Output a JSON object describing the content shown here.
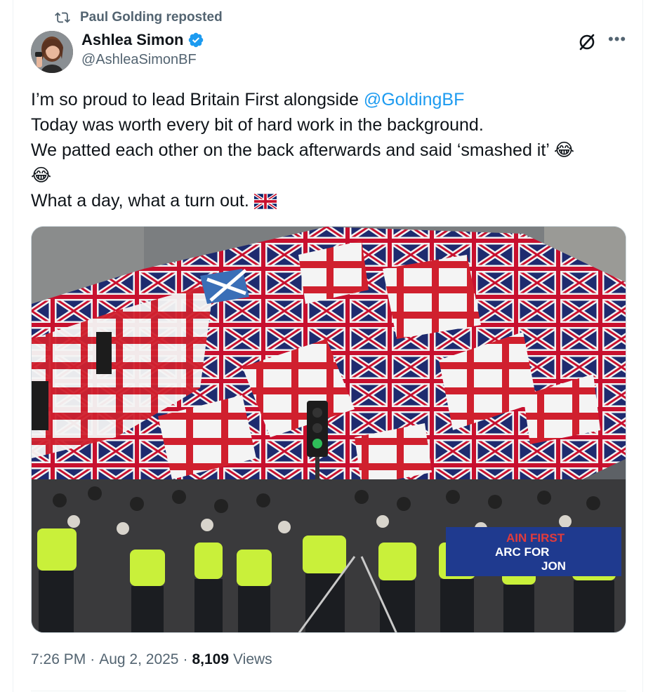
{
  "repost": {
    "text": "Paul Golding reposted"
  },
  "author": {
    "display_name": "Ashlea Simon",
    "handle": "@AshleaSimonBF",
    "verified": true
  },
  "tweet": {
    "line1_prefix": "I’m so proud to lead Britain First alongside ",
    "line1_mention": "@GoldingBF",
    "line2": "Today was worth every bit of hard work in the background.",
    "line3": "We patted each other on the back afterwards and said ‘smashed it’ ",
    "emoji_laugh": "😂",
    "line5": "What a day, what a turn out. ",
    "flag": "uk-flag"
  },
  "media": {
    "banner_line1": "AIN FIRST",
    "banner_line2": "ARC   FOR",
    "banner_line3": "JON"
  },
  "meta": {
    "time": "7:26 PM",
    "separator": "·",
    "date": "Aug 2, 2025",
    "views_count": "8,109",
    "views_label": "Views"
  },
  "colors": {
    "link": "#1d9bf0",
    "secondary_text": "#536471",
    "verified": "#1d9bf0"
  },
  "icons": [
    "repost-icon",
    "verified-badge-icon",
    "grok-icon",
    "more-icon"
  ]
}
